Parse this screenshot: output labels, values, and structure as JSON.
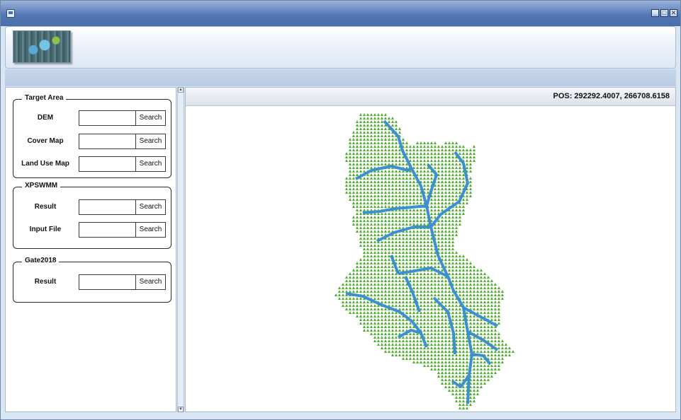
{
  "window": {
    "title_icon": "app-icon",
    "controls": {
      "minimize": "_",
      "maximize": "□",
      "close": "✕"
    }
  },
  "ribbon": {
    "thumbnail": "map-thumbnail"
  },
  "groups": {
    "target_area": {
      "title": "Target Area",
      "rows": [
        {
          "label": "DEM",
          "button": "Search",
          "value": ""
        },
        {
          "label": "Cover Map",
          "button": "Search",
          "value": ""
        },
        {
          "label": "Land Use Map",
          "button": "Search",
          "value": ""
        }
      ]
    },
    "xpswmm": {
      "title": "XPSWMM",
      "rows": [
        {
          "label": "Result",
          "button": "Search",
          "value": ""
        },
        {
          "label": "Input File",
          "button": "Search",
          "value": ""
        }
      ]
    },
    "gate2018": {
      "title": "Gate2018",
      "rows": [
        {
          "label": "Result",
          "button": "Search",
          "value": ""
        }
      ]
    }
  },
  "map": {
    "pos_label": "POS:",
    "pos_value": "292292.4007, 266708.6158",
    "colors": {
      "cells": "#4cae2a",
      "stream": "#3d8fd1"
    }
  }
}
